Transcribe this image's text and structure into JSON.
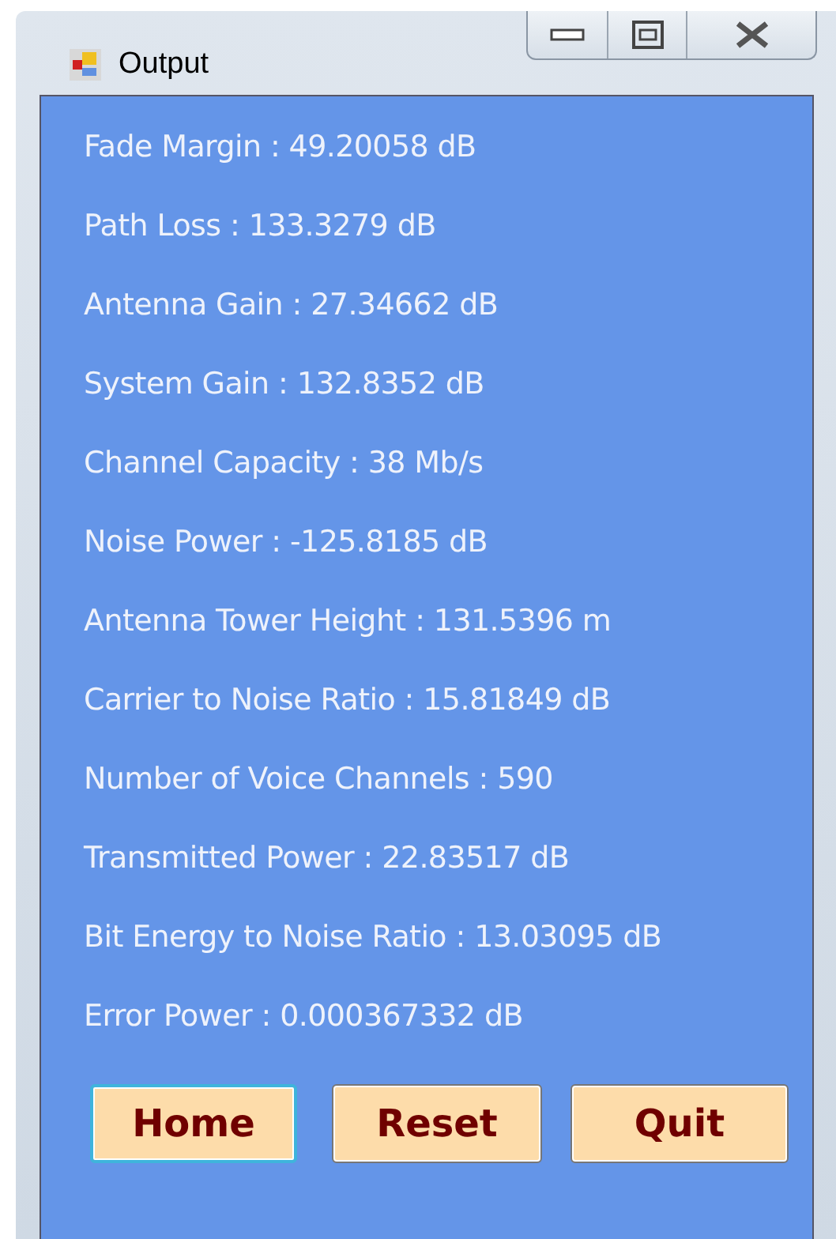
{
  "window": {
    "title": "Output"
  },
  "results": [
    {
      "text": "Fade Margin : 49.20058 dB"
    },
    {
      "text": "Path Loss : 133.3279 dB"
    },
    {
      "text": "Antenna Gain : 27.34662 dB"
    },
    {
      "text": "System Gain : 132.8352 dB"
    },
    {
      "text": "Channel Capacity : 38 Mb/s"
    },
    {
      "text": "Noise Power : -125.8185 dB"
    },
    {
      "text": "Antenna Tower Height : 131.5396 m"
    },
    {
      "text": "Carrier to Noise Ratio : 15.81849 dB"
    },
    {
      "text": "Number of Voice Channels : 590"
    },
    {
      "text": "Transmitted Power : 22.83517 dB"
    },
    {
      "text": "Bit Energy to Noise Ratio : 13.03095 dB"
    },
    {
      "text": "Error Power : 0.000367332 dB"
    }
  ],
  "buttons": [
    {
      "label": "Home",
      "focused": true
    },
    {
      "label": "Reset",
      "focused": false
    },
    {
      "label": "Quit",
      "focused": false
    }
  ]
}
